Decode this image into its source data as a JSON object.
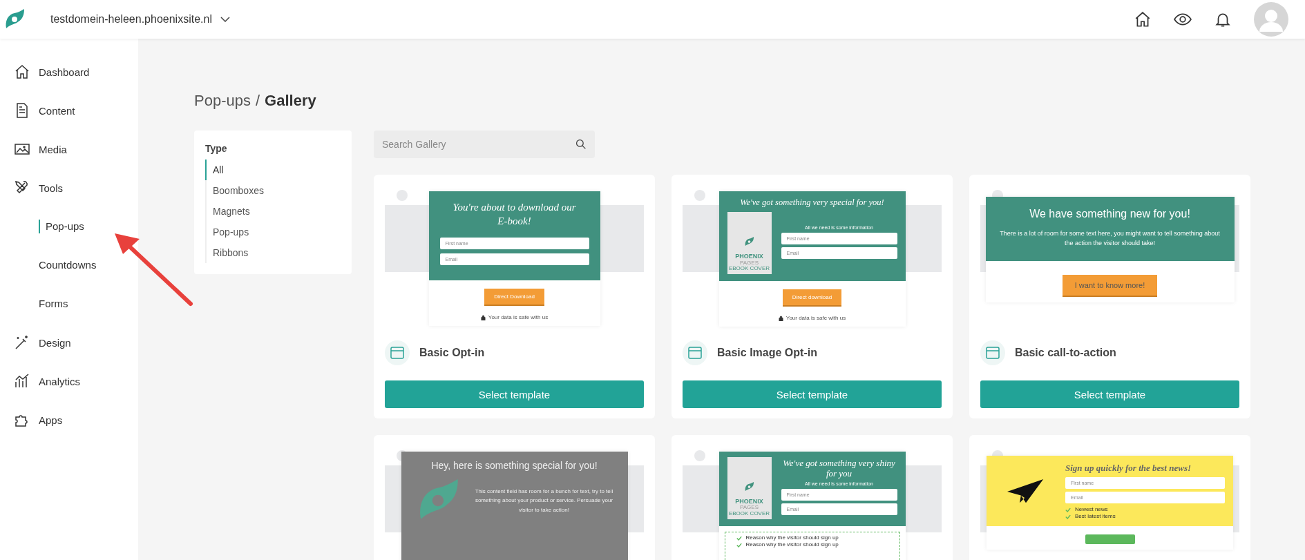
{
  "topbar": {
    "domain": "testdomein-heleen.phoenixsite.nl"
  },
  "sidebar": {
    "items": [
      {
        "label": "Dashboard",
        "kind": "home",
        "selected": false
      },
      {
        "label": "Content",
        "kind": "document",
        "selected": false
      },
      {
        "label": "Media",
        "kind": "image",
        "selected": false
      },
      {
        "label": "Tools",
        "kind": "tools",
        "selected": false,
        "children": [
          {
            "label": "Pop-ups",
            "selected": true
          },
          {
            "label": "Countdowns",
            "selected": false
          },
          {
            "label": "Forms",
            "selected": false
          }
        ]
      },
      {
        "label": "Design",
        "kind": "wand",
        "selected": false
      },
      {
        "label": "Analytics",
        "kind": "chart",
        "selected": false
      },
      {
        "label": "Apps",
        "kind": "puzzle",
        "selected": false
      }
    ]
  },
  "breadcrumb": {
    "parent": "Pop-ups",
    "separator": "/",
    "current": "Gallery"
  },
  "filter": {
    "heading": "Type",
    "options": [
      {
        "label": "All",
        "selected": true
      },
      {
        "label": "Boomboxes",
        "selected": false
      },
      {
        "label": "Magnets",
        "selected": false
      },
      {
        "label": "Pop-ups",
        "selected": false
      },
      {
        "label": "Ribbons",
        "selected": false
      }
    ]
  },
  "search": {
    "placeholder": "Search Gallery"
  },
  "cards": [
    {
      "name": "Basic Opt-in",
      "button": "Select template",
      "preview": {
        "kind": "form",
        "title": "You're about to download our E-book!",
        "fields": [
          "First name",
          "Email"
        ],
        "button": "Direct Download",
        "note": "Your data is safe with us"
      }
    },
    {
      "name": "Basic Image Opt-in",
      "button": "Select template",
      "preview": {
        "kind": "image-form",
        "title": "We've got something very special for you!",
        "subtitle": "All we need is some information",
        "cover": {
          "brand": "PHOENIX",
          "sub": "PAGES",
          "caption": "EBOOK COVER"
        },
        "fields": [
          "First name",
          "Email"
        ],
        "button": "Direct download",
        "note": "Your data is safe with us"
      }
    },
    {
      "name": "Basic call-to-action",
      "button": "Select template",
      "preview": {
        "kind": "cta",
        "title": "We have something new for you!",
        "text": "There is a lot of room for some text here, you might want to tell something about the action the visitor should take!",
        "button": "I want to know more!"
      }
    },
    {
      "preview": {
        "kind": "logo-text",
        "title": "Hey, here is something special for you!",
        "text": "This content field has room for a bunch for text, try to tell something about your product or service. Persuade your visitor to take action!"
      }
    },
    {
      "preview": {
        "kind": "shiny",
        "title": "We've got something very shiny for you",
        "subtitle": "All we need is some information",
        "cover": {
          "brand": "PHOENIX",
          "sub": "PAGES",
          "caption": "EBOOK COVER"
        },
        "fields": [
          "First name",
          "Email"
        ],
        "reasons": [
          "Reason why the visitor should sign up",
          "Reason why the visitor should sign up"
        ]
      }
    },
    {
      "preview": {
        "kind": "yellow",
        "title": "Sign up quickly for the best news!",
        "fields": [
          "First name",
          "Email"
        ],
        "checks": [
          "Newest news",
          "Best latest items"
        ]
      }
    }
  ]
}
